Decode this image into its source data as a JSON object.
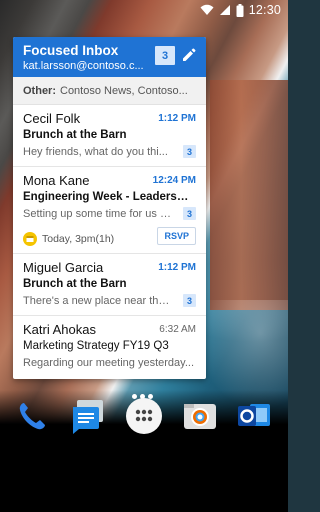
{
  "status_bar": {
    "time": "12:30",
    "icons": [
      "wifi-icon",
      "cell-signal-icon",
      "battery-icon"
    ]
  },
  "widget": {
    "header": {
      "title": "Focused Inbox",
      "account": "kat.larsson@contoso.c...",
      "count": "3",
      "edit_icon": "pencil-icon"
    },
    "other": {
      "label": "Other:",
      "senders": "Contoso News, Contoso..."
    },
    "emails": [
      {
        "sender": "Cecil Folk",
        "time": "1:12 PM",
        "subject": "Brunch at the Barn",
        "preview": "Hey friends, what do you thi...",
        "count": "3",
        "unread": true
      },
      {
        "sender": "Mona Kane",
        "time": "12:24 PM",
        "subject": "Engineering Week - Leadership...",
        "preview": "Setting up some time for us al...",
        "count": "3",
        "event_text": "Today, 3pm(1h)",
        "event_action": "RSVP",
        "unread": true
      },
      {
        "sender": "Miguel Garcia",
        "time": "1:12 PM",
        "subject": "Brunch at the Barn",
        "preview": "There's a new place near the...",
        "count": "3",
        "unread": true
      },
      {
        "sender": "Katri Ahokas",
        "time": "6:32 AM",
        "subject": "Marketing Strategy FY19 Q3",
        "preview": "Regarding our meeting yesterday...",
        "unread": false
      }
    ]
  },
  "dock": {
    "apps": [
      "phone-icon",
      "messages-icon",
      "app-drawer-icon",
      "camera-icon",
      "outlook-icon"
    ]
  },
  "colors": {
    "accent": "#1f73d4",
    "badge_bg": "#d7e7fb",
    "event_yellow": "#f5c400"
  }
}
